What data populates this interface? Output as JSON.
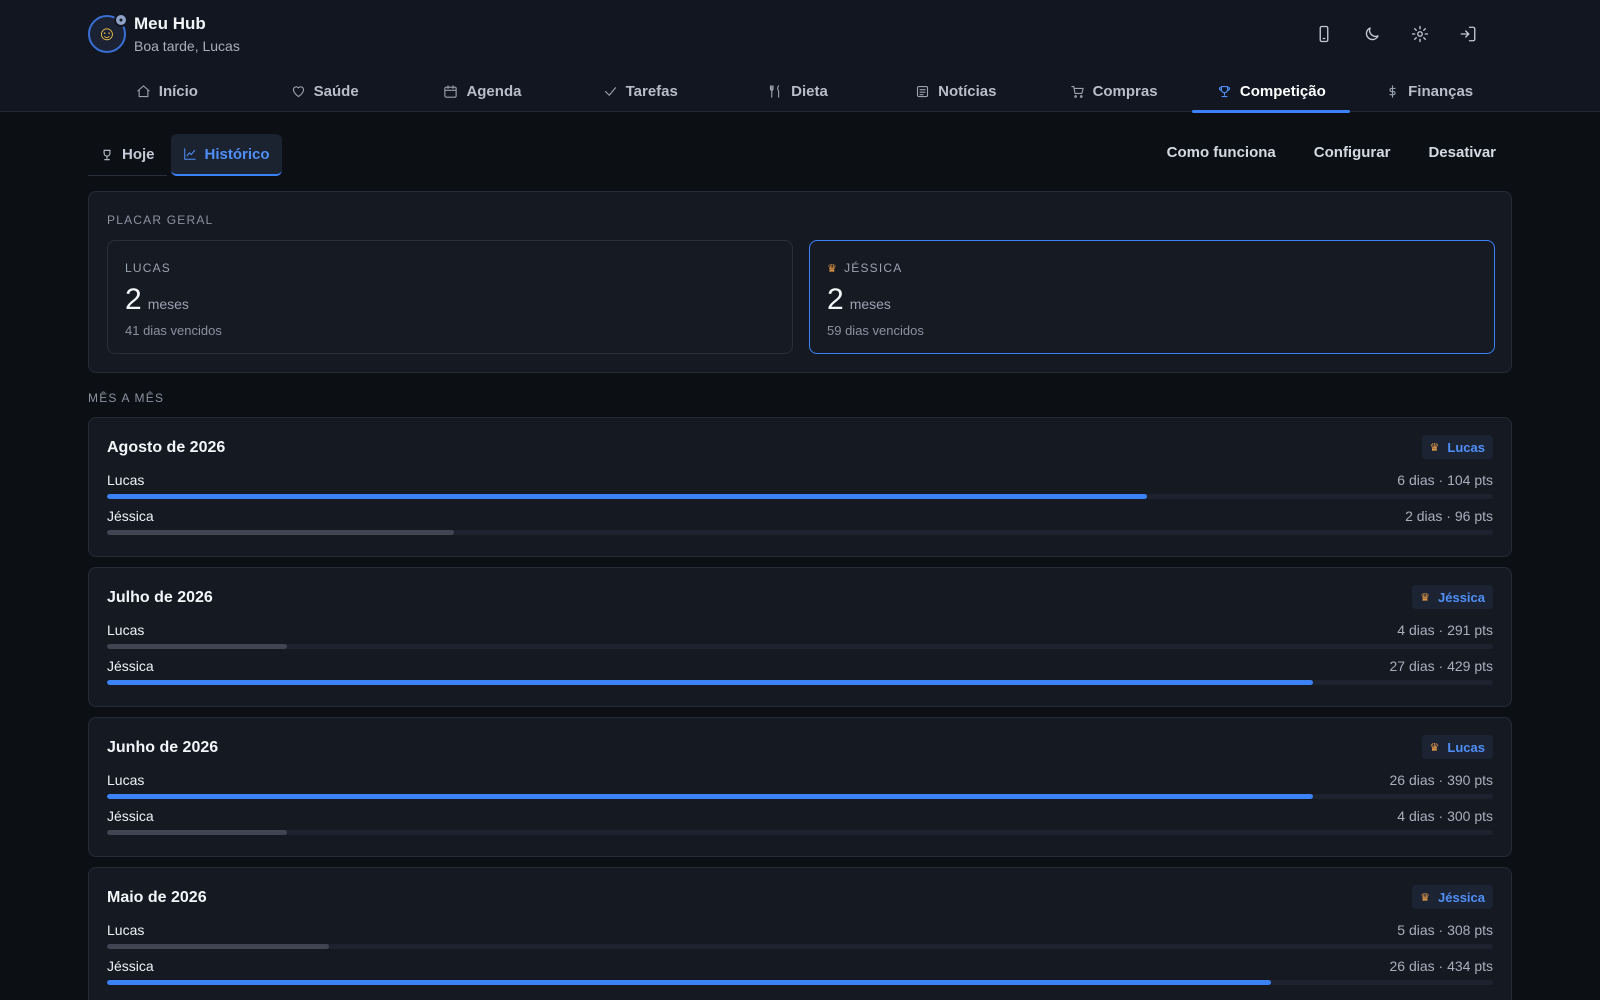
{
  "app": {
    "title": "Meu Hub",
    "greeting": "Boa tarde, Lucas"
  },
  "top_actions": [
    {
      "icon": "phone-icon"
    },
    {
      "icon": "moon-icon"
    },
    {
      "icon": "gear-icon"
    },
    {
      "icon": "logout-icon"
    }
  ],
  "nav": [
    {
      "label": "Início",
      "icon": "home-icon"
    },
    {
      "label": "Saúde",
      "icon": "heart-icon"
    },
    {
      "label": "Agenda",
      "icon": "calendar-icon"
    },
    {
      "label": "Tarefas",
      "icon": "check-icon"
    },
    {
      "label": "Dieta",
      "icon": "utensils-icon"
    },
    {
      "label": "Notícias",
      "icon": "newspaper-icon"
    },
    {
      "label": "Compras",
      "icon": "cart-icon"
    },
    {
      "label": "Competição",
      "icon": "trophy-icon",
      "active": true
    },
    {
      "label": "Finanças",
      "icon": "dollar-icon"
    }
  ],
  "subtabs": [
    {
      "label": "Hoje",
      "icon": "trophy-icon"
    },
    {
      "label": "Histórico",
      "icon": "chart-line-icon",
      "active": true
    }
  ],
  "sub_actions": {
    "how": "Como funciona",
    "configure": "Configurar",
    "disable": "Desativar"
  },
  "scoreboard": {
    "label": "PLACAR GERAL",
    "players": [
      {
        "name": "LUCAS",
        "value": "2",
        "unit": "meses",
        "detail": "41 dias vencidos",
        "leader": false
      },
      {
        "name": "JÉSSICA",
        "value": "2",
        "unit": "meses",
        "detail": "59 dias vencidos",
        "leader": true
      }
    ]
  },
  "monthly_label": "MÊS A MÊS",
  "accent_color": "#3b82f6",
  "months": [
    {
      "title": "Agosto de 2026",
      "winner": "Lucas",
      "rows": [
        {
          "name": "Lucas",
          "stats": "6 dias · 104 pts",
          "fraction": 0.75,
          "winner": true
        },
        {
          "name": "Jéssica",
          "stats": "2 dias · 96 pts",
          "fraction": 0.25,
          "winner": false
        }
      ]
    },
    {
      "title": "Julho de 2026",
      "winner": "Jéssica",
      "rows": [
        {
          "name": "Lucas",
          "stats": "4 dias · 291 pts",
          "fraction": 0.13,
          "winner": false
        },
        {
          "name": "Jéssica",
          "stats": "27 dias · 429 pts",
          "fraction": 0.87,
          "winner": true
        }
      ]
    },
    {
      "title": "Junho de 2026",
      "winner": "Lucas",
      "rows": [
        {
          "name": "Lucas",
          "stats": "26 dias · 390 pts",
          "fraction": 0.87,
          "winner": true
        },
        {
          "name": "Jéssica",
          "stats": "4 dias · 300 pts",
          "fraction": 0.13,
          "winner": false
        }
      ]
    },
    {
      "title": "Maio de 2026",
      "winner": "Jéssica",
      "rows": [
        {
          "name": "Lucas",
          "stats": "5 dias · 308 pts",
          "fraction": 0.16,
          "winner": false
        },
        {
          "name": "Jéssica",
          "stats": "26 dias · 434 pts",
          "fraction": 0.84,
          "winner": true
        }
      ]
    }
  ]
}
